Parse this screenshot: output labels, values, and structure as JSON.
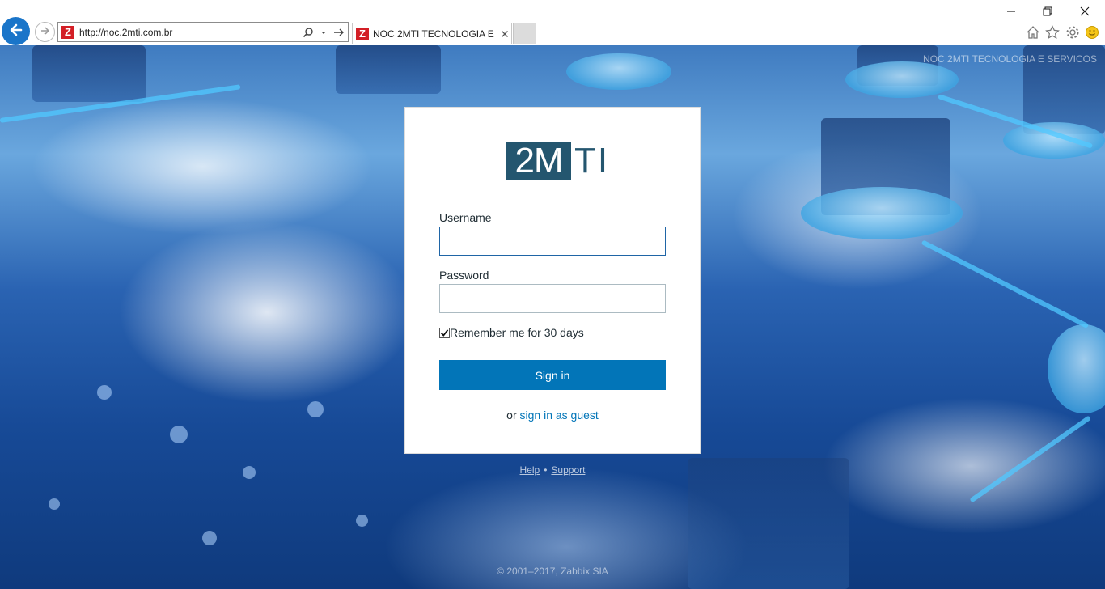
{
  "browser": {
    "url": "http://noc.2mti.com.br",
    "tab_title": "NOC 2MTI TECNOLOGIA E ...",
    "favicon_letter": "Z",
    "icons": {
      "back": "arrow-left-icon",
      "forward": "arrow-right-icon",
      "search": "search-icon",
      "dropdown": "chevron-down-icon",
      "go": "go-arrow-icon",
      "tab_close": "close-icon",
      "minimize": "minimize-icon",
      "restore": "restore-icon",
      "close": "close-icon",
      "home": "home-icon",
      "favorites": "star-icon",
      "tools": "gear-icon",
      "feedback": "smiley-icon"
    }
  },
  "page": {
    "site_title": "NOC 2MTI TECNOLOGIA E SERVICOS",
    "logo": {
      "dark_part": "2M",
      "light_part": "TI"
    },
    "form": {
      "username_label": "Username",
      "username_value": "",
      "password_label": "Password",
      "password_value": "",
      "remember_label": "Remember me for 30 days",
      "remember_checked": true,
      "signin_label": "Sign in",
      "guest_prefix": "or",
      "guest_link": "sign in as guest"
    },
    "footer": {
      "help": "Help",
      "separator": "•",
      "support": "Support",
      "copyright": "© 2001–2017, Zabbix SIA"
    }
  },
  "colors": {
    "accent": "#0275b8",
    "logo": "#24566f",
    "favicon": "#d31f26",
    "back_button": "#1a75c9"
  }
}
